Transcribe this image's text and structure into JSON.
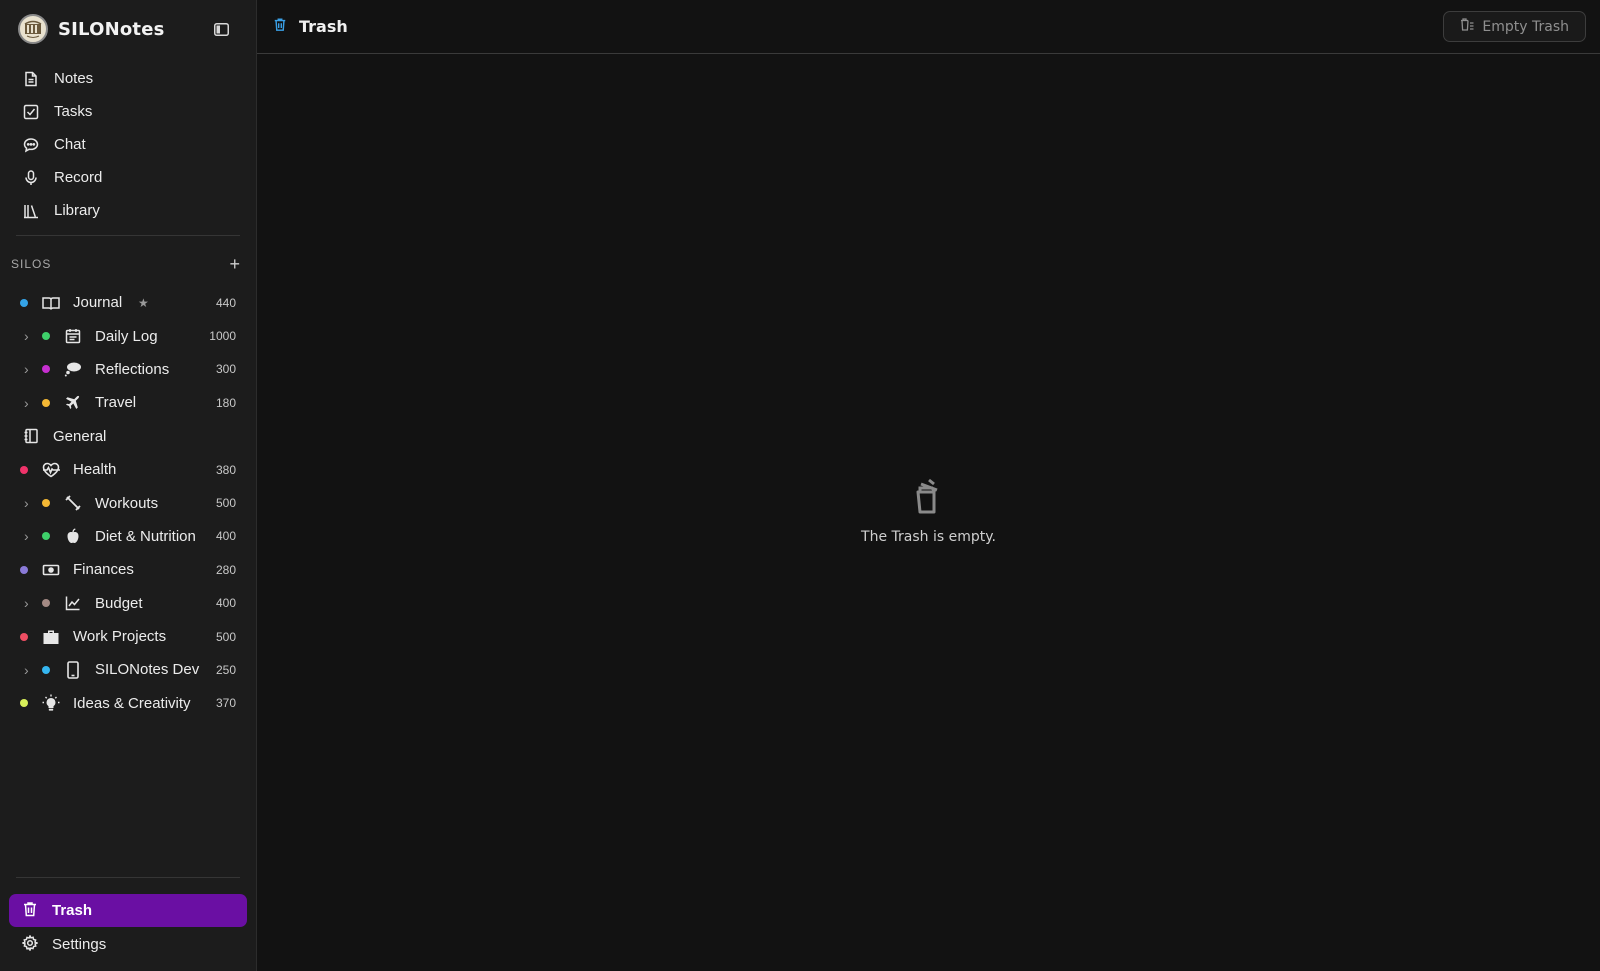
{
  "app": {
    "name": "SILONotes"
  },
  "nav": [
    {
      "label": "Notes",
      "icon": "document-icon"
    },
    {
      "label": "Tasks",
      "icon": "checkbox-icon"
    },
    {
      "label": "Chat",
      "icon": "chat-icon"
    },
    {
      "label": "Record",
      "icon": "microphone-icon"
    },
    {
      "label": "Library",
      "icon": "library-icon"
    }
  ],
  "silos_section": {
    "title": "SILOS",
    "add_label": "+"
  },
  "silos": [
    {
      "label": "Journal",
      "count": "440",
      "dot": "#35a4e8",
      "icon": "book-icon",
      "level": 0,
      "starred": true,
      "star": "★"
    },
    {
      "label": "Daily Log",
      "count": "1000",
      "dot": "#3ecf6a",
      "icon": "calendar-icon",
      "level": 1
    },
    {
      "label": "Reflections",
      "count": "300",
      "dot": "#c62fd0",
      "icon": "thought-bubble-icon",
      "level": 1
    },
    {
      "label": "Travel",
      "count": "180",
      "dot": "#f4b834",
      "icon": "airplane-icon",
      "level": 1
    },
    {
      "label": "General",
      "count": "",
      "dot": "",
      "icon": "notebook-icon",
      "level": 0
    },
    {
      "label": "Health",
      "count": "380",
      "dot": "#f0336a",
      "icon": "heart-pulse-icon",
      "level": 0
    },
    {
      "label": "Workouts",
      "count": "500",
      "dot": "#f4b834",
      "icon": "dumbbell-icon",
      "level": 1
    },
    {
      "label": "Diet & Nutrition",
      "count": "400",
      "dot": "#3ecf6a",
      "icon": "apple-icon",
      "level": 1
    },
    {
      "label": "Finances",
      "count": "280",
      "dot": "#8a7ad8",
      "icon": "money-icon",
      "level": 0
    },
    {
      "label": "Budget",
      "count": "400",
      "dot": "#a48a84",
      "icon": "line-chart-icon",
      "level": 1
    },
    {
      "label": "Work Projects",
      "count": "500",
      "dot": "#ee4e63",
      "icon": "briefcase-icon",
      "level": 0
    },
    {
      "label": "SILONotes Dev",
      "count": "250",
      "dot": "#35b6f0",
      "icon": "phone-icon",
      "level": 1
    },
    {
      "label": "Ideas & Creativity",
      "count": "370",
      "dot": "#d8f05a",
      "icon": "lightbulb-icon",
      "level": 0
    }
  ],
  "chevron": "›",
  "bottom": {
    "trash_label": "Trash",
    "settings_label": "Settings"
  },
  "header": {
    "title": "Trash",
    "empty_button": "Empty Trash"
  },
  "empty_state": {
    "message": "The Trash is empty."
  },
  "colors": {
    "accent": "#6a0fa3",
    "trash_icon_header": "#3aa0e6"
  }
}
